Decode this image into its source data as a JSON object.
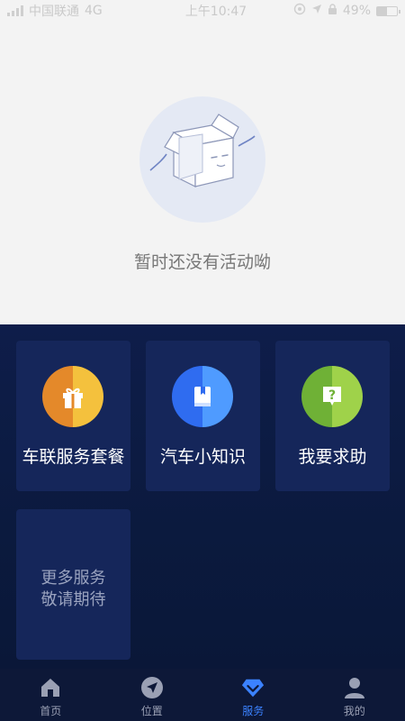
{
  "status_bar": {
    "carrier": "中国联通",
    "network": "4G",
    "time": "上午10:47",
    "battery": "49%",
    "battery_level": 0.49
  },
  "empty_state": {
    "message": "暂时还没有活动呦"
  },
  "services": [
    {
      "label": "车联服务套餐",
      "icon": "gift-icon",
      "color": "#f0a233"
    },
    {
      "label": "汽车小知识",
      "icon": "book-icon",
      "color": "#3a7bff"
    },
    {
      "label": "我要求助",
      "icon": "help-icon",
      "color": "#8bc53f"
    }
  ],
  "more_card": {
    "line1": "更多服务",
    "line2": "敬请期待"
  },
  "tabs": [
    {
      "label": "首页",
      "icon": "home-icon",
      "active": false
    },
    {
      "label": "位置",
      "icon": "location-icon",
      "active": false
    },
    {
      "label": "服务",
      "icon": "diamond-icon",
      "active": true
    },
    {
      "label": "我的",
      "icon": "user-icon",
      "active": false
    }
  ],
  "colors": {
    "service_bg": "#0e1d4a",
    "card_bg": "#15265a",
    "tab_active": "#3b82ff",
    "tab_inactive": "#9aa0b4"
  }
}
